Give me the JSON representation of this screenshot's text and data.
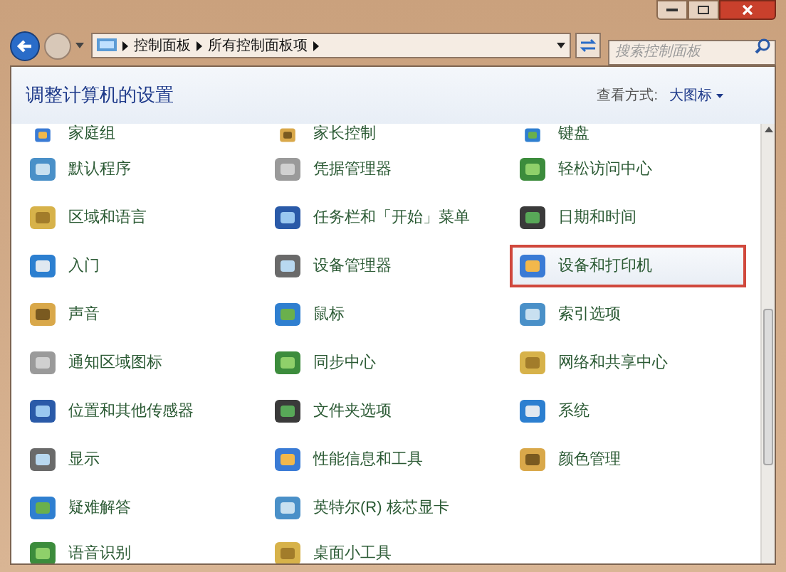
{
  "address_bar": {
    "breadcrumb": [
      "控制面板",
      "所有控制面板项"
    ]
  },
  "search": {
    "placeholder": "搜索控制面板"
  },
  "header": {
    "title": "调整计算机的设置",
    "view_label": "查看方式:",
    "view_value": "大图标"
  },
  "rows": [
    [
      {
        "label": "家庭组",
        "selected": false
      },
      {
        "label": "家长控制",
        "selected": false
      },
      {
        "label": "键盘",
        "selected": false
      }
    ],
    [
      {
        "label": "默认程序",
        "selected": false
      },
      {
        "label": "凭据管理器",
        "selected": false
      },
      {
        "label": "轻松访问中心",
        "selected": false
      }
    ],
    [
      {
        "label": "区域和语言",
        "selected": false
      },
      {
        "label": "任务栏和「开始」菜单",
        "selected": false
      },
      {
        "label": "日期和时间",
        "selected": false
      }
    ],
    [
      {
        "label": "入门",
        "selected": false
      },
      {
        "label": "设备管理器",
        "selected": false
      },
      {
        "label": "设备和打印机",
        "selected": true
      }
    ],
    [
      {
        "label": "声音",
        "selected": false
      },
      {
        "label": "鼠标",
        "selected": false
      },
      {
        "label": "索引选项",
        "selected": false
      }
    ],
    [
      {
        "label": "通知区域图标",
        "selected": false
      },
      {
        "label": "同步中心",
        "selected": false
      },
      {
        "label": "网络和共享中心",
        "selected": false
      }
    ],
    [
      {
        "label": "位置和其他传感器",
        "selected": false
      },
      {
        "label": "文件夹选项",
        "selected": false
      },
      {
        "label": "系统",
        "selected": false
      }
    ],
    [
      {
        "label": "显示",
        "selected": false
      },
      {
        "label": "性能信息和工具",
        "selected": false
      },
      {
        "label": "颜色管理",
        "selected": false
      }
    ],
    [
      {
        "label": "疑难解答",
        "selected": false
      },
      {
        "label": "英特尔(R) 核芯显卡",
        "selected": false
      }
    ],
    [
      {
        "label": "语音识别",
        "selected": false
      },
      {
        "label": "桌面小工具",
        "selected": false
      }
    ]
  ]
}
